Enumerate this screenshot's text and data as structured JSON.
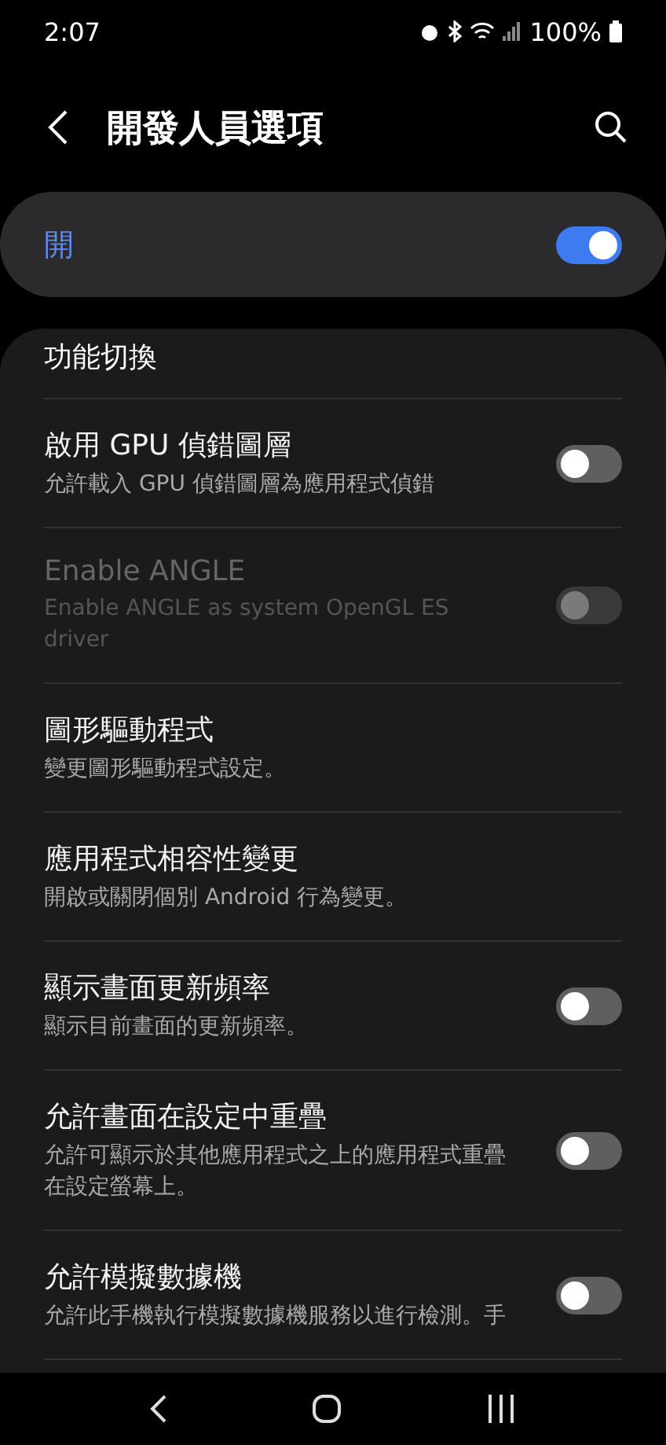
{
  "status_bar": {
    "time": "2:07",
    "battery": "100%"
  },
  "header": {
    "title": "開發人員選項"
  },
  "master": {
    "label": "開",
    "on": true
  },
  "section": {
    "title": "功能切換"
  },
  "rows": [
    {
      "kind": "switch",
      "title": "啟用 GPU 偵錯圖層",
      "subtitle": "允許載入 GPU 偵錯圖層為應用程式偵錯",
      "on": false,
      "disabled": false
    },
    {
      "kind": "switch",
      "title": "Enable ANGLE",
      "subtitle": "Enable ANGLE as system OpenGL ES driver",
      "on": false,
      "disabled": true
    },
    {
      "kind": "link",
      "title": "圖形驅動程式",
      "subtitle": "變更圖形驅動程式設定。"
    },
    {
      "kind": "link",
      "title": "應用程式相容性變更",
      "subtitle": "開啟或關閉個別 Android 行為變更。"
    },
    {
      "kind": "switch",
      "title": "顯示畫面更新頻率",
      "subtitle": "顯示目前畫面的更新頻率。",
      "on": false,
      "disabled": false
    },
    {
      "kind": "switch",
      "title": "允許畫面在設定中重疊",
      "subtitle": "允許可顯示於其他應用程式之上的應用程式重疊在設定螢幕上。",
      "on": false,
      "disabled": false
    },
    {
      "kind": "switch",
      "title": "允許模擬數據機",
      "subtitle": "允許此手機執行模擬數據機服務以進行檢測。手",
      "on": false,
      "disabled": false
    }
  ]
}
